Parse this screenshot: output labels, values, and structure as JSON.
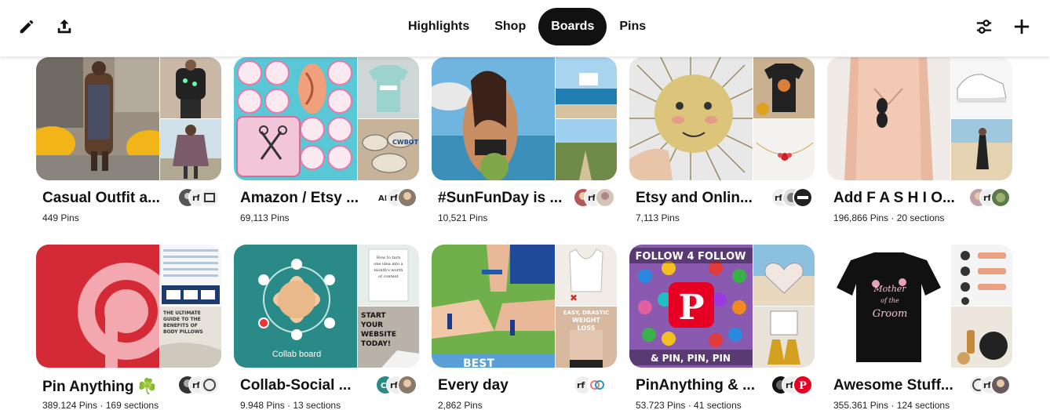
{
  "header": {
    "tabs": [
      {
        "label": "Highlights",
        "active": false
      },
      {
        "label": "Shop",
        "active": false
      },
      {
        "label": "Boards",
        "active": true
      },
      {
        "label": "Pins",
        "active": false
      }
    ],
    "icons": [
      "edit-icon",
      "share-icon",
      "filter-icon",
      "plus-icon"
    ]
  },
  "boards": [
    {
      "title": "Casual Outfit a...",
      "meta": "449 Pins"
    },
    {
      "title": "Amazon / Etsy ...",
      "meta": "69,113 Pins"
    },
    {
      "title": "#SunFunDay is ...",
      "meta": "10,521 Pins"
    },
    {
      "title": "Etsy and Onlin...",
      "meta": "7,113 Pins"
    },
    {
      "title": "Add F A S H I O...",
      "meta": "196,866 Pins · 20 sections"
    },
    {
      "title": "Pin Anything ☘️",
      "meta": "389.124 Pins · 169 sections"
    },
    {
      "title": "Collab-Social ...",
      "meta": "9.948 Pins · 13 sections"
    },
    {
      "title": "Every day",
      "meta": "2,862 Pins"
    },
    {
      "title": "PinAnything & ...",
      "meta": "53.723 Pins · 41 sections"
    },
    {
      "title": "Awesome Stuff...",
      "meta": "355.361 Pins · 124 sections"
    }
  ],
  "collage_text": {
    "collab_board": "Collab board",
    "follow4follow": "FOLLOW 4 FOLLOW",
    "pin_pin_pin": "& PIN, PIN, PIN",
    "start_website": "START YOUR WEBSITE TODAY!",
    "turn_idea": "How to turn one idea into a month's worth of content",
    "body_pillows": "THE ULTIMATE GUIDE TO THE BENEFITS OF BODY PILLOWS",
    "weight_loss": "EASY, DRASTIC WEIGHT LOSS",
    "best": "BEST",
    "mother_groom": "Mother of the Groom"
  },
  "colors": {
    "tab_active_bg": "#111111",
    "pinterest_red": "#e60023"
  }
}
